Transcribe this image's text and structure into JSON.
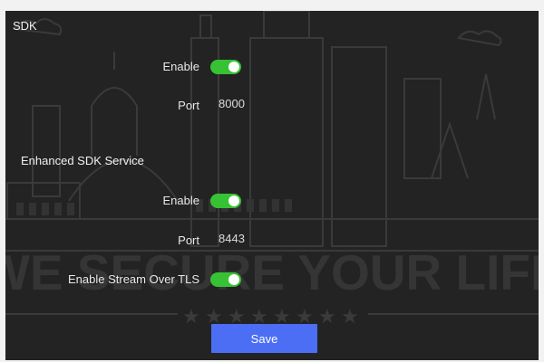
{
  "sdk": {
    "title": "SDK",
    "enable_label": "Enable",
    "enable_on": true,
    "port_label": "Port",
    "port_value": "8000"
  },
  "enhanced": {
    "title": "Enhanced SDK Service",
    "enable_label": "Enable",
    "enable_on": true,
    "port_label": "Port",
    "port_value": "8443",
    "tls_label": "Enable Stream Over TLS",
    "tls_on": true
  },
  "watermark": {
    "text": "WE SECURE YOUR LIFE"
  },
  "actions": {
    "save_label": "Save"
  },
  "colors": {
    "background": "#232323",
    "toggle_on": "#36c234",
    "primary_button": "#4b6ef5"
  }
}
